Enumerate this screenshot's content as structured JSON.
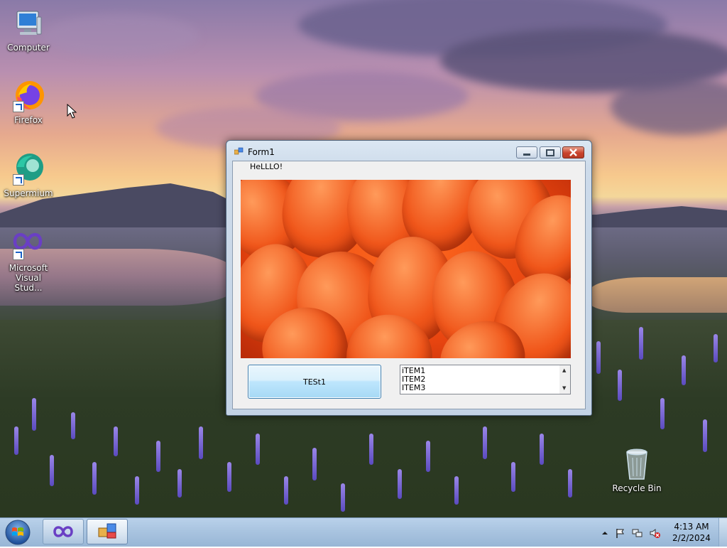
{
  "desktop": {
    "icons": [
      {
        "label": "Computer"
      },
      {
        "label": "Firefox"
      },
      {
        "label": "Supermium"
      },
      {
        "label": "Microsoft Visual Stud..."
      },
      {
        "label": "Recycle Bin"
      }
    ]
  },
  "window": {
    "title": "Form1",
    "label_text": "HeLLLO!",
    "button_label": "TESt1",
    "listbox_items": [
      "iTEM1",
      "ITEM2",
      "ITEM3"
    ],
    "controls": {
      "minimize": "minimize",
      "maximize": "maximize",
      "close": "close"
    }
  },
  "taskbar": {
    "time": "4:13 AM",
    "date": "2/2/2024",
    "pinned": [
      "visual-studio",
      "form1-app"
    ]
  },
  "colors": {
    "accent": "#3c7fb1",
    "close_red": "#c9422c",
    "taskbar": "#a9c4e0"
  }
}
